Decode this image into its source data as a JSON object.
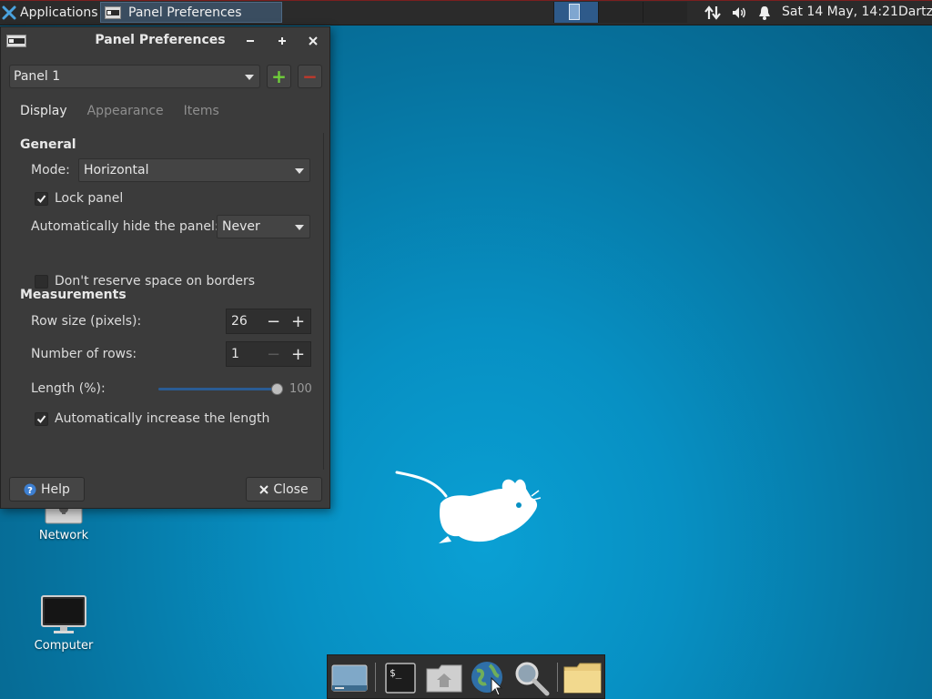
{
  "colors": {
    "desktop": "#0790c3",
    "panel": "#2b2b2b",
    "dialog": "#3b3b3b",
    "add": "#6fcf3a",
    "remove": "#c0392b",
    "slider_fill": "#2a5c94"
  },
  "top_panel": {
    "apps_label": "Applications",
    "apps_icon": "xfce-mouse-icon",
    "task_label": "Panel Preferences",
    "workspaces": [
      {
        "active": true
      },
      {
        "active": false
      },
      {
        "active": false
      }
    ],
    "tray_icons": [
      "network-icon",
      "volume-icon",
      "notification-bell-icon"
    ],
    "clock": "Sat 14 May, 14:21",
    "user": "Dartz"
  },
  "desktop": {
    "icons": [
      {
        "label": "Network",
        "icon": "network-drive-icon"
      },
      {
        "label": "Computer",
        "icon": "computer-monitor-icon"
      }
    ]
  },
  "dock": {
    "items": [
      "show-desktop-icon",
      "terminal-icon",
      "home-folder-icon",
      "web-browser-icon",
      "search-icon",
      "folder-icon"
    ]
  },
  "dialog": {
    "title": "Panel Preferences",
    "panel_select": "Panel 1",
    "add_label": "+",
    "remove_label": "−",
    "tabs": [
      "Display",
      "Appearance",
      "Items"
    ],
    "active_tab": "Display",
    "general": {
      "heading": "General",
      "mode_label": "Mode:",
      "mode_value": "Horizontal",
      "lock_panel_label": "Lock panel",
      "lock_panel_checked": true,
      "autohide_label": "Automatically hide the panel:",
      "autohide_value": "Never",
      "reserve_label": "Don't reserve space on borders",
      "reserve_checked": false
    },
    "measurements": {
      "heading": "Measurements",
      "row_size_label": "Row size (pixels):",
      "row_size_value": "26",
      "rows_label": "Number of rows:",
      "rows_value": "1",
      "length_label": "Length (%):",
      "length_value": "100",
      "length_fraction": 1.0,
      "auto_length_label": "Automatically increase the length",
      "auto_length_checked": true
    },
    "help_label": "Help",
    "close_label": "Close"
  }
}
